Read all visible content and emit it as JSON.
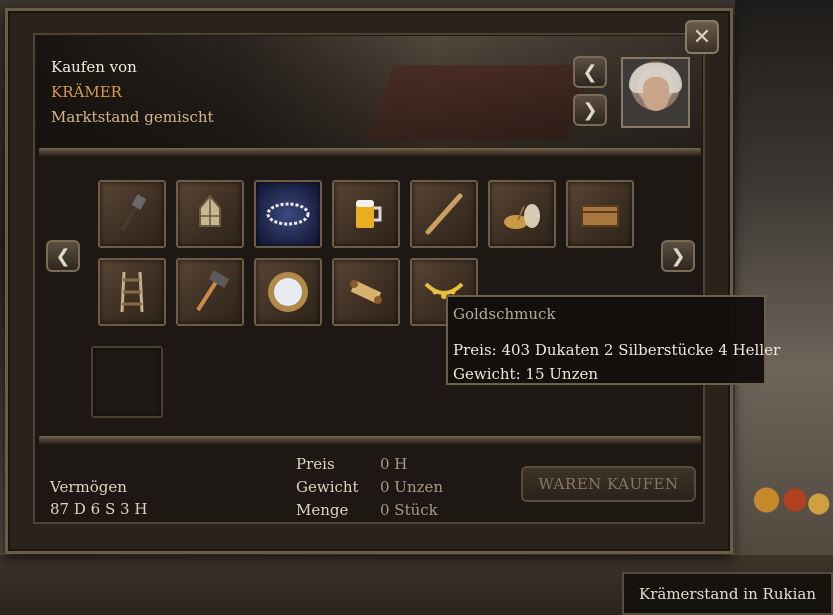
{
  "header": {
    "buy_from": "Kaufen von",
    "merchant": "KRÄMER",
    "stall": "Marktstand gemischt"
  },
  "items": [
    {
      "name": "Schaufel-Werkzeug",
      "icon": "shovel-icon"
    },
    {
      "name": "Laterne",
      "icon": "lantern-icon"
    },
    {
      "name": "Halskette",
      "icon": "necklace-icon"
    },
    {
      "name": "Bier",
      "icon": "beer-mug-icon"
    },
    {
      "name": "Flöte",
      "icon": "flute-icon"
    },
    {
      "name": "Gewürze",
      "icon": "bowl-and-sack-icon"
    },
    {
      "name": "Truhe",
      "icon": "chest-icon"
    },
    {
      "name": "Strickleiter",
      "icon": "rope-ladder-icon"
    },
    {
      "name": "Hammer",
      "icon": "hammer-icon"
    },
    {
      "name": "Spiegel",
      "icon": "mirror-icon"
    },
    {
      "name": "Schriftrolle",
      "icon": "scroll-icon"
    },
    {
      "name": "Goldschmuck",
      "icon": "gold-jewelry-icon"
    }
  ],
  "tooltip": {
    "title": "Goldschmuck",
    "price": "Preis: 403 Dukaten 2 Silberstücke 4 Heller",
    "weight": "Gewicht: 15 Unzen"
  },
  "footer": {
    "wealth_label": "Vermögen",
    "wealth_value": "87 D 6 S 3 H",
    "price_label": "Preis",
    "price_value": "0 H",
    "weight_label": "Gewicht",
    "weight_value": "0 Unzen",
    "quantity_label": "Menge",
    "quantity_value": "0 Stück",
    "buy_button": "WAREN KAUFEN"
  },
  "location": "Krämerstand in Rukian",
  "icons": {
    "close": "close-icon",
    "prev": "chevron-left-icon",
    "next": "chevron-right-icon"
  },
  "colors": {
    "accent_orange": "#d99a4a",
    "panel_bg": "#1d1813",
    "border_brown": "#6e5c48"
  }
}
